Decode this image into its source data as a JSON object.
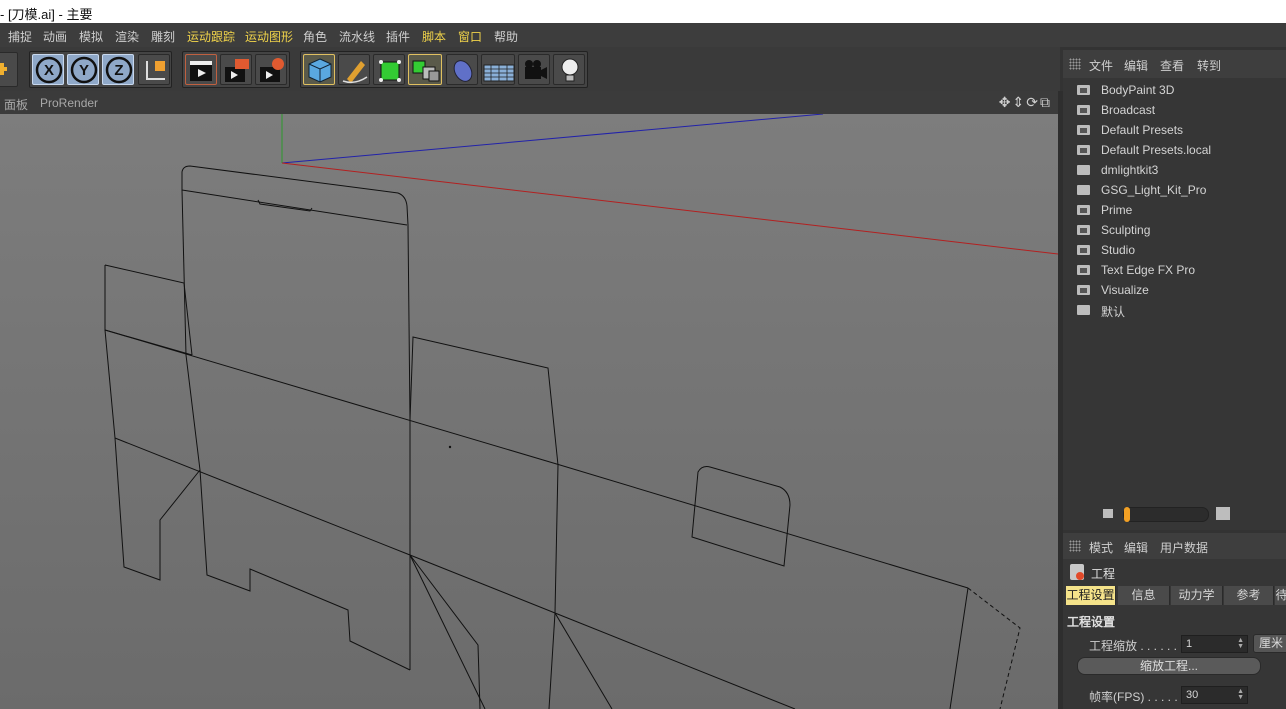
{
  "window": {
    "title": "- [刀模.ai] - 主要"
  },
  "menu": [
    {
      "label": "捕捉",
      "highlight": false
    },
    {
      "label": "动画",
      "highlight": false
    },
    {
      "label": "模拟",
      "highlight": false
    },
    {
      "label": "渲染",
      "highlight": false
    },
    {
      "label": "雕刻",
      "highlight": false
    },
    {
      "label": "运动跟踪",
      "highlight": true
    },
    {
      "label": "运动图形",
      "highlight": true
    },
    {
      "label": "角色",
      "highlight": false
    },
    {
      "label": "流水线",
      "highlight": false
    },
    {
      "label": "插件",
      "highlight": false
    },
    {
      "label": "脚本",
      "highlight": true
    },
    {
      "label": "窗口",
      "highlight": true
    },
    {
      "label": "帮助",
      "highlight": false
    }
  ],
  "toolbar": {
    "axis_labels": [
      "X",
      "Y",
      "Z"
    ]
  },
  "viewport": {
    "menu": [
      "面板",
      "ProRender"
    ]
  },
  "content_browser": {
    "menu": [
      "文件",
      "编辑",
      "查看",
      "转到"
    ],
    "items": [
      {
        "label": "BodyPaint 3D",
        "icon": "library-icon"
      },
      {
        "label": "Broadcast",
        "icon": "library-icon"
      },
      {
        "label": "Default Presets",
        "icon": "library-icon"
      },
      {
        "label": "Default Presets.local",
        "icon": "library-icon"
      },
      {
        "label": "dmlightkit3",
        "icon": "folder-icon"
      },
      {
        "label": "GSG_Light_Kit_Pro",
        "icon": "folder-icon"
      },
      {
        "label": "Prime",
        "icon": "library-icon"
      },
      {
        "label": "Sculpting",
        "icon": "library-icon"
      },
      {
        "label": "Studio",
        "icon": "library-icon"
      },
      {
        "label": "Text Edge FX Pro",
        "icon": "library-icon"
      },
      {
        "label": "Visualize",
        "icon": "library-icon"
      },
      {
        "label": "默认",
        "icon": "folder-icon"
      }
    ]
  },
  "attributes": {
    "menu": [
      "模式",
      "编辑",
      "用户数据"
    ],
    "object": "工程",
    "tabs": [
      "工程设置",
      "信息",
      "动力学",
      "参考",
      "待"
    ],
    "active_tab": "工程设置",
    "section": "工程设置",
    "scale": {
      "label": "工程缩放 . . . . . . .",
      "value": "1",
      "unit": "厘米"
    },
    "scale_button": "缩放工程...",
    "fps": {
      "label": "帧率(FPS) . . . . . .",
      "value": "30"
    }
  },
  "colors": {
    "accent": "#f0d34a",
    "active_tab": "#f5e38a",
    "slider_knob": "#f2a024"
  }
}
